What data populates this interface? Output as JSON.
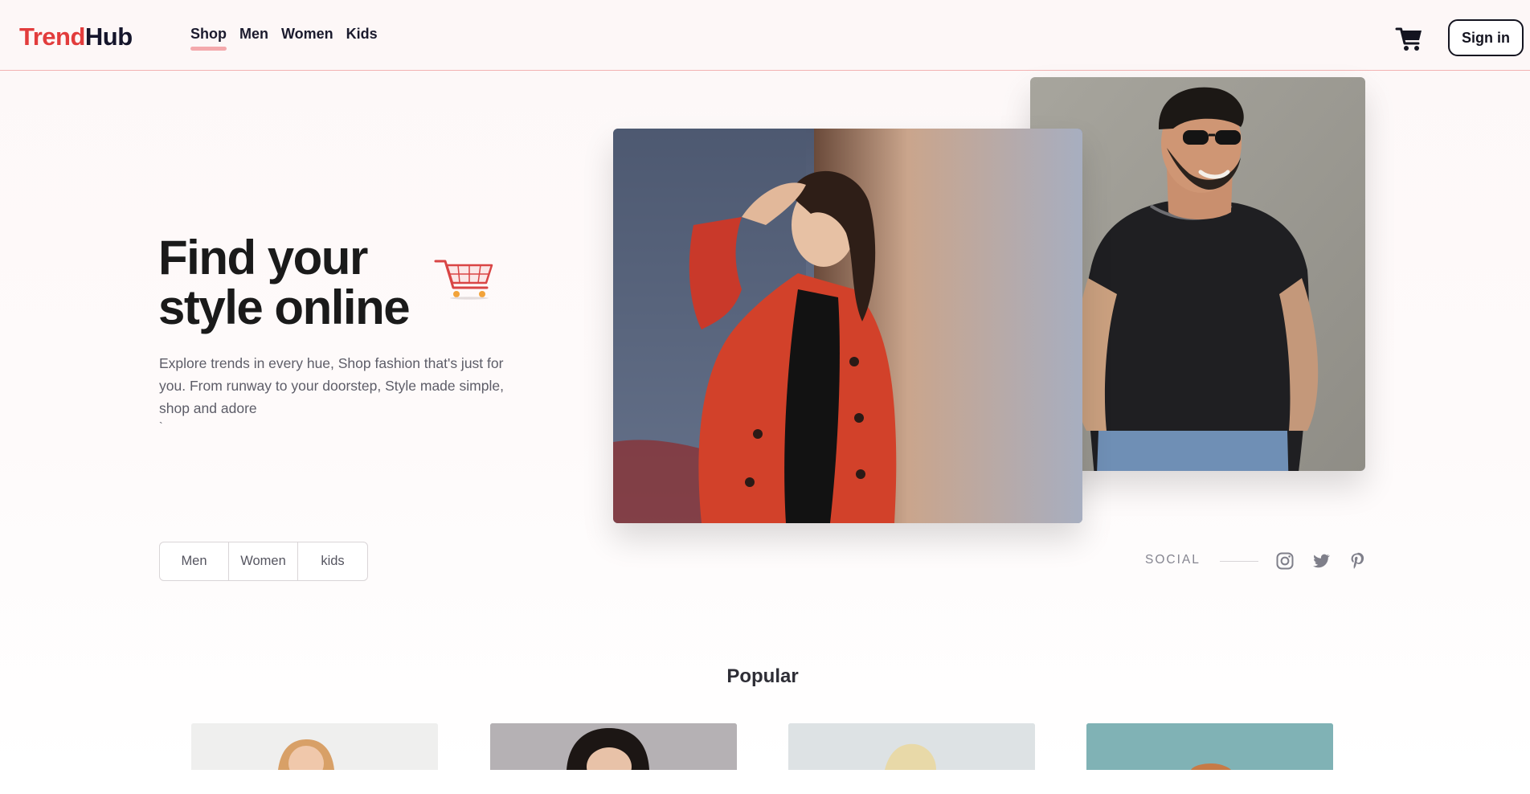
{
  "brand": {
    "part1": "Trend",
    "part2": "Hub"
  },
  "nav": {
    "items": [
      {
        "label": "Shop",
        "active": true
      },
      {
        "label": "Men"
      },
      {
        "label": "Women"
      },
      {
        "label": "Kids"
      }
    ]
  },
  "header": {
    "signin_label": "Sign in"
  },
  "hero": {
    "title": "Find your style online",
    "description": "Explore trends in every hue, Shop fashion that's just for you. From runway to your doorstep, Style made simple, shop and adore",
    "tick": "`"
  },
  "filters": [
    "Men",
    "Women",
    "kids"
  ],
  "social": {
    "label": "SOCIAL",
    "icons": [
      "instagram-icon",
      "twitter-icon",
      "pinterest-icon"
    ]
  },
  "popular": {
    "title": "Popular"
  },
  "colors": {
    "brand_red": "#e23c3c",
    "dark": "#15152b",
    "nav_underline": "#f4a9ac",
    "header_border": "#f2b3b3"
  }
}
